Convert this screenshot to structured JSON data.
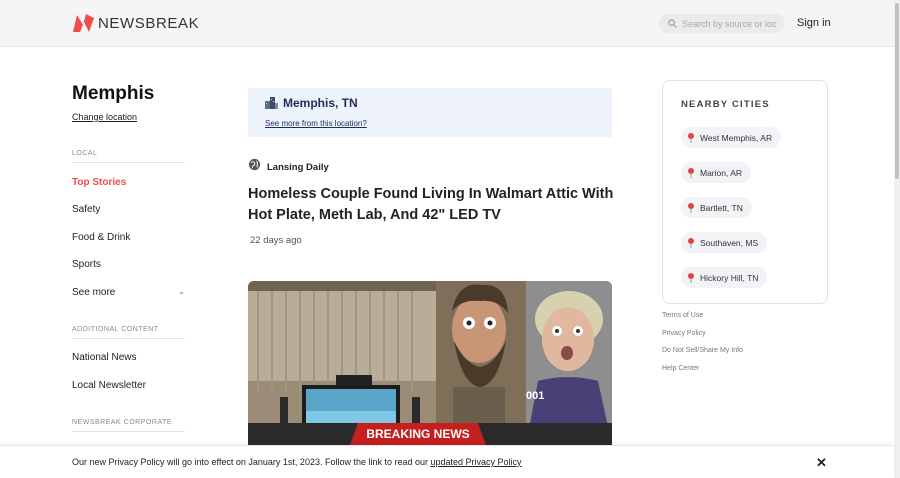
{
  "header": {
    "brand": "NEWSBREAK",
    "search_placeholder": "Search by source or loc",
    "signin": "Sign in"
  },
  "sidebar": {
    "city": "Memphis",
    "change_location": "Change location",
    "local_label": "LOCAL",
    "local_items": [
      "Top Stories",
      "Safety",
      "Food & Drink",
      "Sports",
      "See more"
    ],
    "additional_label": "ADDITIONAL CONTENT",
    "additional_items": [
      "National News",
      "Local Newsletter"
    ],
    "corporate_label": "NEWSBREAK CORPORATE"
  },
  "location_box": {
    "title": "Memphis, TN",
    "more": "See more from this location?"
  },
  "article": {
    "source": "Lansing Daily",
    "headline": "Homeless Couple Found Living In Walmart Attic With Hot Plate, Meth Lab, And 42\" LED TV",
    "time": "22 days ago",
    "image_banner": "BREAKING NEWS",
    "image_tag": "001"
  },
  "nearby": {
    "title": "NEARBY CITIES",
    "cities": [
      "West Memphis, AR",
      "Marion, AR",
      "Bartlett, TN",
      "Southaven, MS",
      "Hickory Hill, TN"
    ]
  },
  "footer_links": [
    "Terms of Use",
    "Privacy Policy",
    "Do Not Sell/Share My Info",
    "Help Center"
  ],
  "privacy_bar": {
    "text": "Our new Privacy Policy will go into effect on January 1st, 2023. Follow the link to read our ",
    "link": "updated Privacy Policy",
    "close": "✕"
  },
  "colors": {
    "brand_red": "#f04d4d",
    "location_bg": "#eef2fb",
    "location_text": "#1f2e5a"
  }
}
